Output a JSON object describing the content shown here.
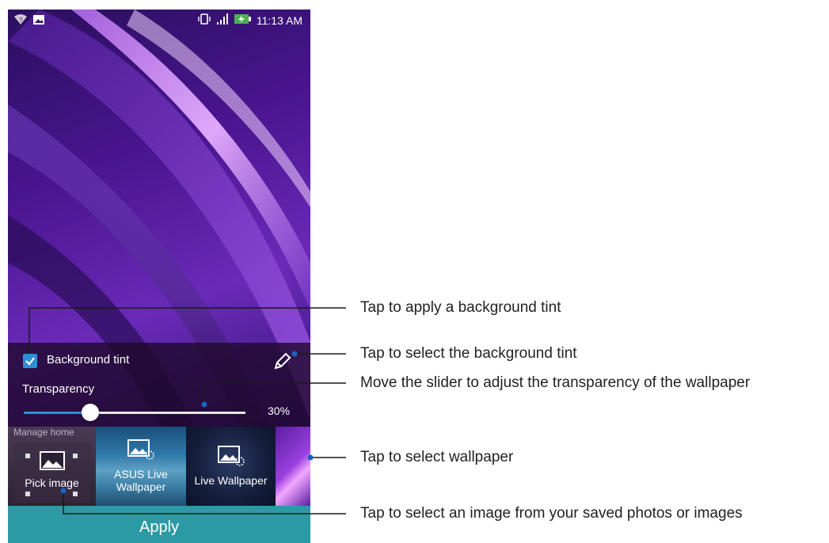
{
  "status_bar": {
    "time": "11:13 AM",
    "left_icons": [
      "wifi-question-icon",
      "image-notification-icon"
    ],
    "right_icons": [
      "vibrate-icon",
      "signal-icon",
      "battery-charging-icon"
    ]
  },
  "panel": {
    "background_tint_label": "Background tint",
    "background_tint_checked": true,
    "transparency_label": "Transparency",
    "transparency_percent_text": "30%",
    "transparency_value": 0.3
  },
  "wallpapers": {
    "manage_home_label": "Manage home",
    "pick_image_label": "Pick image",
    "asus_live_label_line1": "ASUS Live",
    "asus_live_label_line2": "Wallpaper",
    "live_wallpaper_label": "Live Wallpaper"
  },
  "apply_label": "Apply",
  "callouts": {
    "apply_tint": "Tap to apply a background tint",
    "select_tint": "Tap to select the background tint",
    "slider": "Move the slider to adjust the transparency of the wallpaper",
    "select_wallpaper": "Tap to select wallpaper",
    "select_image": "Tap to select an image from your saved photos or images"
  },
  "colors": {
    "accent_blue": "#2f8fd6",
    "apply_teal": "#2b9aa4",
    "callout_line": "#1a1a1a",
    "callout_dot": "#1565c0"
  }
}
